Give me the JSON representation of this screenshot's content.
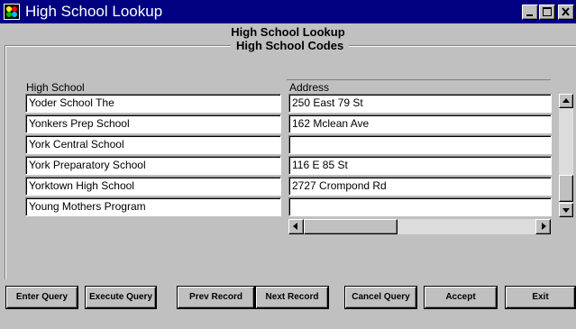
{
  "window": {
    "title": "High School Lookup",
    "icon": "oracle-forms-icon",
    "controls": [
      "minimize-icon",
      "maximize-icon",
      "close-icon"
    ]
  },
  "form": {
    "title": "High School Lookup",
    "frame_title": "High School Codes"
  },
  "table": {
    "columns": [
      "High School",
      "Address"
    ],
    "rows": [
      {
        "school": "Yoder School The",
        "address": "250 East 79 St"
      },
      {
        "school": "Yonkers Prep School",
        "address": "162 Mclean Ave"
      },
      {
        "school": "York Central School",
        "address": ""
      },
      {
        "school": "York Preparatory School",
        "address": "116 E 85 St"
      },
      {
        "school": "Yorktown High School",
        "address": "2727 Crompond Rd"
      },
      {
        "school": "Young Mothers Program",
        "address": ""
      }
    ]
  },
  "buttons": {
    "enter_query": "Enter Query",
    "execute_query": "Execute Query",
    "prev_record": "Prev Record",
    "next_record": "Next Record",
    "cancel_query": "Cancel Query",
    "accept": "Accept",
    "exit": "Exit"
  },
  "colors": {
    "titlebar": "#000080",
    "background": "#c0c0c0",
    "field": "#ffffff"
  }
}
